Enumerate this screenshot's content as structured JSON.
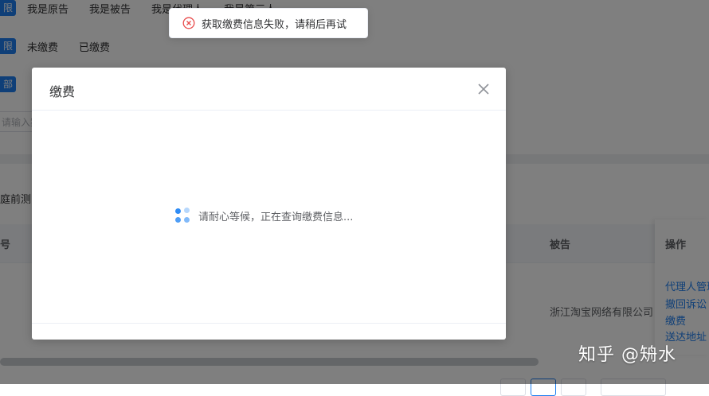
{
  "filters": {
    "row1": {
      "tag": "限",
      "options": [
        "我是原告",
        "我是被告",
        "我是代理人",
        "我是第三人"
      ]
    },
    "row2": {
      "tag": "限",
      "options": [
        "未缴费",
        "已缴费"
      ]
    },
    "row3": {
      "tag": "部"
    }
  },
  "search": {
    "placeholder": "请输入案"
  },
  "sub_label": "庭前测",
  "table": {
    "headers": {
      "number": "号",
      "defendant": "被告",
      "operations": "操作"
    },
    "row": {
      "defendant": "浙江淘宝网络有限公司"
    },
    "operations": [
      "代理人管理",
      "撤回诉讼",
      "缴费",
      "送达地址"
    ]
  },
  "dialog": {
    "title": "缴费",
    "loading_text": "请耐心等候，正在查询缴费信息..."
  },
  "toast": {
    "message": "获取缴费信息失败，请稍后再试"
  },
  "watermark": "知乎 @矪水",
  "colors": {
    "primary": "#1e7ff0",
    "error": "#e84b4b",
    "mask": "rgba(0,0,0,0.5)"
  }
}
